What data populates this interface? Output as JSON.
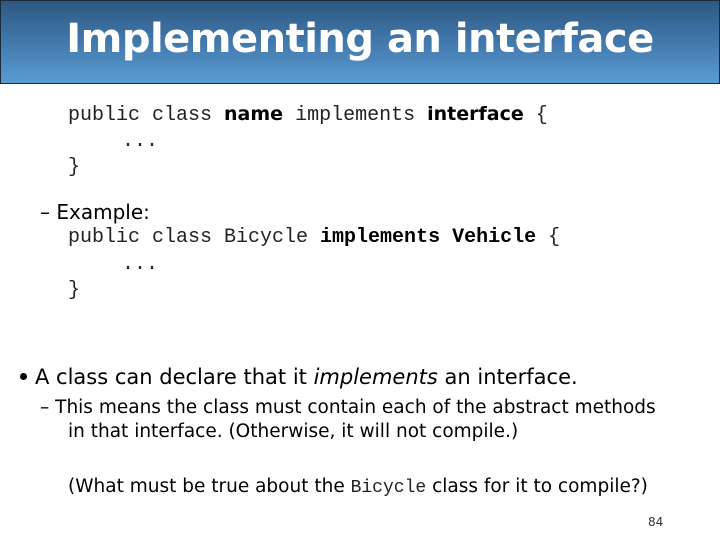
{
  "slide": {
    "title": "Implementing an interface",
    "page_number": "84"
  },
  "syntax": {
    "line1": {
      "kw": "public class ",
      "name": "name",
      "implements": " implements ",
      "interface": "interface",
      "brace": " {"
    },
    "line2": "...",
    "line3": "}"
  },
  "example": {
    "dash": "–",
    "label": "Example:",
    "line1": {
      "kw": "public class Bicycle ",
      "implements": "implements",
      "space": " ",
      "vehicle": "Vehicle",
      "brace": " {"
    },
    "line2": "...",
    "line3": "}"
  },
  "bullet": {
    "pre": "A class can declare that it ",
    "italic": "implements",
    "post": " an interface."
  },
  "sub_bullet": {
    "dash": "–",
    "line1": "This means the class must contain each of the abstract methods",
    "line2": "in that interface.  (Otherwise, it will not compile.)"
  },
  "question": {
    "pre": "(What must be true about the ",
    "code": "Bicycle",
    "post": " class for it to compile?)"
  }
}
